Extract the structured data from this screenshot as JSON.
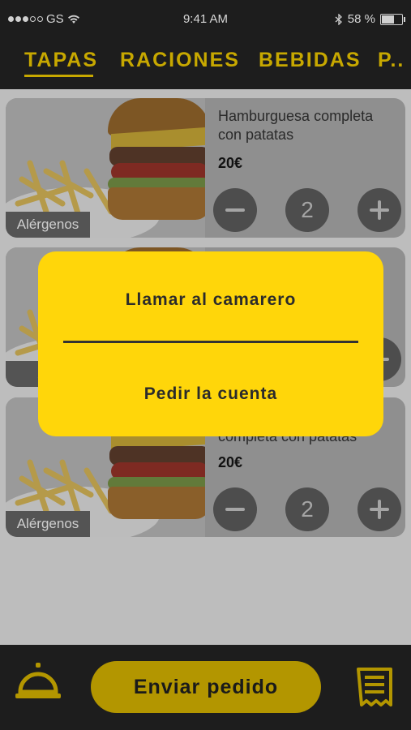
{
  "status": {
    "carrier": "GS",
    "time": "9:41 AM",
    "battery": "58 %",
    "battery_level": 0.58
  },
  "tabs": [
    {
      "label": "TAPAS",
      "active": true
    },
    {
      "label": "RACIONES",
      "active": false
    },
    {
      "label": "BEBIDAS",
      "active": false
    },
    {
      "label": "P..",
      "active": false
    }
  ],
  "products": [
    {
      "name": "Hamburguesa completa con patatas",
      "price": "20€",
      "quantity": "2",
      "allergens": "Alérgenos"
    },
    {
      "name": "",
      "price": "",
      "quantity": "",
      "allergens": "Alé"
    },
    {
      "name": "completa con patatas",
      "price": "20€",
      "quantity": "2",
      "allergens": "Alérgenos"
    }
  ],
  "modal": {
    "option_1": "Llamar al camarero",
    "option_2": "Pedir la cuenta"
  },
  "bottom": {
    "send_label": "Enviar pedido"
  },
  "colors": {
    "accent": "#ffd60a",
    "dark_bar": "#1d1d1d",
    "dimmed_accent": "#b39600"
  }
}
